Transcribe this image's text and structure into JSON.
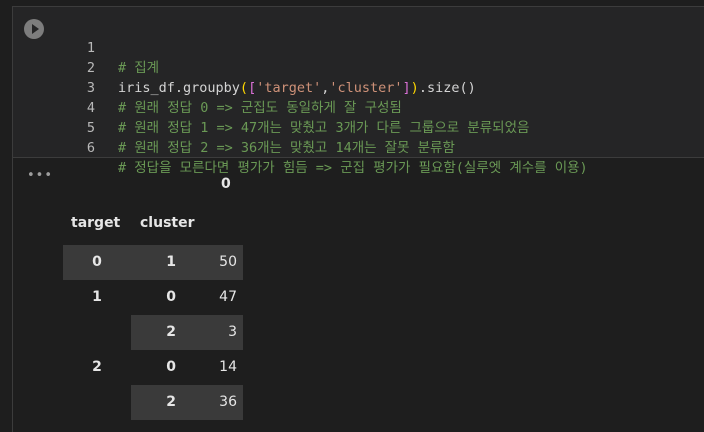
{
  "code": {
    "line_numbers": [
      "1",
      "2",
      "3",
      "4",
      "5",
      "6"
    ],
    "line1": "# 집계",
    "line2_fn": "iris_df.groupby",
    "line2_open_paren": "(",
    "line2_open_bracket": "[",
    "line2_str1": "'target'",
    "line2_comma": ",",
    "line2_str2": "'cluster'",
    "line2_close_bracket": "]",
    "line2_close_paren": ")",
    "line2_tail": ".size()",
    "line3": "# 원래 정답 0 => 군집도 동일하게 잘 구성됨",
    "line4": "# 원래 정답 1 => 47개는 맞췄고 3개가 다른 그룹으로 분류되었음",
    "line5": "# 원래 정답 2 => 36개는 맞췄고 14개는 잘못 분류함",
    "line6": "# 정답을 모른다면 평가가 힘듬 => 군집 평가가 필요함(실루엣 계수를 이용)"
  },
  "output": {
    "more_label": "•••",
    "column_header": "0",
    "index_names": [
      "target",
      "cluster"
    ],
    "rows": [
      {
        "target": "0",
        "cluster": "1",
        "value": "50"
      },
      {
        "target": "1",
        "cluster": "0",
        "value": "47"
      },
      {
        "target": "",
        "cluster": "2",
        "value": "3"
      },
      {
        "target": "2",
        "cluster": "0",
        "value": "14"
      },
      {
        "target": "",
        "cluster": "2",
        "value": "36"
      }
    ]
  },
  "colors": {
    "background": "#1e1e1e",
    "comment": "#6a9955",
    "string": "#ce9178",
    "bracket_gold": "#ffd700",
    "bracket_purple": "#da70d6",
    "row_shade": "#3a3a3a"
  }
}
